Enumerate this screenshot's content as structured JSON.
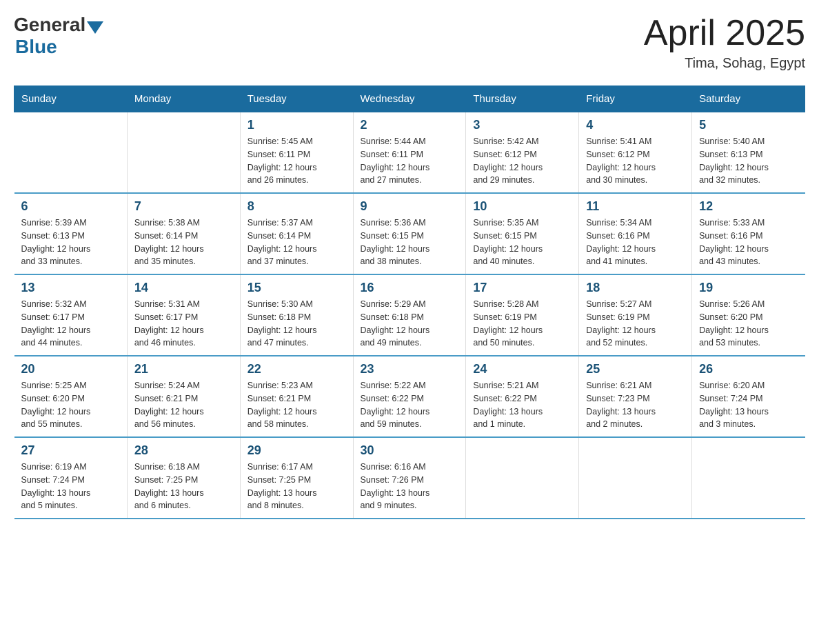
{
  "header": {
    "logo_general": "General",
    "logo_blue": "Blue",
    "title": "April 2025",
    "location": "Tima, Sohag, Egypt"
  },
  "weekdays": [
    "Sunday",
    "Monday",
    "Tuesday",
    "Wednesday",
    "Thursday",
    "Friday",
    "Saturday"
  ],
  "weeks": [
    [
      {
        "day": "",
        "info": ""
      },
      {
        "day": "",
        "info": ""
      },
      {
        "day": "1",
        "info": "Sunrise: 5:45 AM\nSunset: 6:11 PM\nDaylight: 12 hours\nand 26 minutes."
      },
      {
        "day": "2",
        "info": "Sunrise: 5:44 AM\nSunset: 6:11 PM\nDaylight: 12 hours\nand 27 minutes."
      },
      {
        "day": "3",
        "info": "Sunrise: 5:42 AM\nSunset: 6:12 PM\nDaylight: 12 hours\nand 29 minutes."
      },
      {
        "day": "4",
        "info": "Sunrise: 5:41 AM\nSunset: 6:12 PM\nDaylight: 12 hours\nand 30 minutes."
      },
      {
        "day": "5",
        "info": "Sunrise: 5:40 AM\nSunset: 6:13 PM\nDaylight: 12 hours\nand 32 minutes."
      }
    ],
    [
      {
        "day": "6",
        "info": "Sunrise: 5:39 AM\nSunset: 6:13 PM\nDaylight: 12 hours\nand 33 minutes."
      },
      {
        "day": "7",
        "info": "Sunrise: 5:38 AM\nSunset: 6:14 PM\nDaylight: 12 hours\nand 35 minutes."
      },
      {
        "day": "8",
        "info": "Sunrise: 5:37 AM\nSunset: 6:14 PM\nDaylight: 12 hours\nand 37 minutes."
      },
      {
        "day": "9",
        "info": "Sunrise: 5:36 AM\nSunset: 6:15 PM\nDaylight: 12 hours\nand 38 minutes."
      },
      {
        "day": "10",
        "info": "Sunrise: 5:35 AM\nSunset: 6:15 PM\nDaylight: 12 hours\nand 40 minutes."
      },
      {
        "day": "11",
        "info": "Sunrise: 5:34 AM\nSunset: 6:16 PM\nDaylight: 12 hours\nand 41 minutes."
      },
      {
        "day": "12",
        "info": "Sunrise: 5:33 AM\nSunset: 6:16 PM\nDaylight: 12 hours\nand 43 minutes."
      }
    ],
    [
      {
        "day": "13",
        "info": "Sunrise: 5:32 AM\nSunset: 6:17 PM\nDaylight: 12 hours\nand 44 minutes."
      },
      {
        "day": "14",
        "info": "Sunrise: 5:31 AM\nSunset: 6:17 PM\nDaylight: 12 hours\nand 46 minutes."
      },
      {
        "day": "15",
        "info": "Sunrise: 5:30 AM\nSunset: 6:18 PM\nDaylight: 12 hours\nand 47 minutes."
      },
      {
        "day": "16",
        "info": "Sunrise: 5:29 AM\nSunset: 6:18 PM\nDaylight: 12 hours\nand 49 minutes."
      },
      {
        "day": "17",
        "info": "Sunrise: 5:28 AM\nSunset: 6:19 PM\nDaylight: 12 hours\nand 50 minutes."
      },
      {
        "day": "18",
        "info": "Sunrise: 5:27 AM\nSunset: 6:19 PM\nDaylight: 12 hours\nand 52 minutes."
      },
      {
        "day": "19",
        "info": "Sunrise: 5:26 AM\nSunset: 6:20 PM\nDaylight: 12 hours\nand 53 minutes."
      }
    ],
    [
      {
        "day": "20",
        "info": "Sunrise: 5:25 AM\nSunset: 6:20 PM\nDaylight: 12 hours\nand 55 minutes."
      },
      {
        "day": "21",
        "info": "Sunrise: 5:24 AM\nSunset: 6:21 PM\nDaylight: 12 hours\nand 56 minutes."
      },
      {
        "day": "22",
        "info": "Sunrise: 5:23 AM\nSunset: 6:21 PM\nDaylight: 12 hours\nand 58 minutes."
      },
      {
        "day": "23",
        "info": "Sunrise: 5:22 AM\nSunset: 6:22 PM\nDaylight: 12 hours\nand 59 minutes."
      },
      {
        "day": "24",
        "info": "Sunrise: 5:21 AM\nSunset: 6:22 PM\nDaylight: 13 hours\nand 1 minute."
      },
      {
        "day": "25",
        "info": "Sunrise: 6:21 AM\nSunset: 7:23 PM\nDaylight: 13 hours\nand 2 minutes."
      },
      {
        "day": "26",
        "info": "Sunrise: 6:20 AM\nSunset: 7:24 PM\nDaylight: 13 hours\nand 3 minutes."
      }
    ],
    [
      {
        "day": "27",
        "info": "Sunrise: 6:19 AM\nSunset: 7:24 PM\nDaylight: 13 hours\nand 5 minutes."
      },
      {
        "day": "28",
        "info": "Sunrise: 6:18 AM\nSunset: 7:25 PM\nDaylight: 13 hours\nand 6 minutes."
      },
      {
        "day": "29",
        "info": "Sunrise: 6:17 AM\nSunset: 7:25 PM\nDaylight: 13 hours\nand 8 minutes."
      },
      {
        "day": "30",
        "info": "Sunrise: 6:16 AM\nSunset: 7:26 PM\nDaylight: 13 hours\nand 9 minutes."
      },
      {
        "day": "",
        "info": ""
      },
      {
        "day": "",
        "info": ""
      },
      {
        "day": "",
        "info": ""
      }
    ]
  ]
}
